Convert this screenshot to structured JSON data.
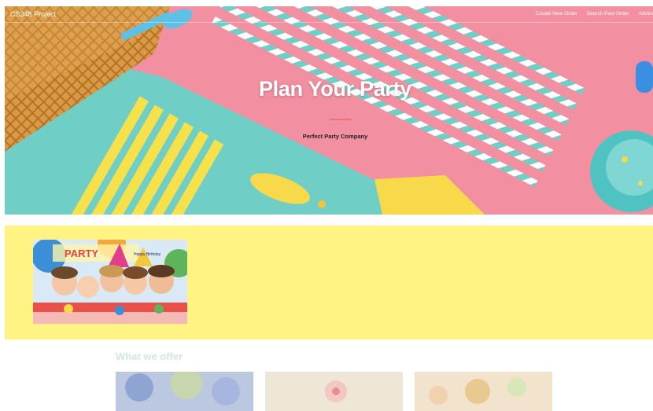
{
  "nav": {
    "brand": "CS348 Project",
    "links": [
      "Create New Order",
      "Search Past Order",
      "Admin"
    ]
  },
  "hero": {
    "title": "Plan Your Party",
    "subtitle": "Perfect Party Company"
  },
  "photo": {
    "banner_text": "PARTY",
    "hat_text": "Happy Birthday"
  },
  "offer": {
    "heading": "What we offer"
  },
  "colors": {
    "hero_pink": "#f28fa0",
    "hero_teal": "#6fcfc6",
    "hero_yellow": "#f7d94a",
    "band_yellow": "#fff384",
    "offer_heading": "#cfe9dc",
    "divider": "#e8747c"
  }
}
